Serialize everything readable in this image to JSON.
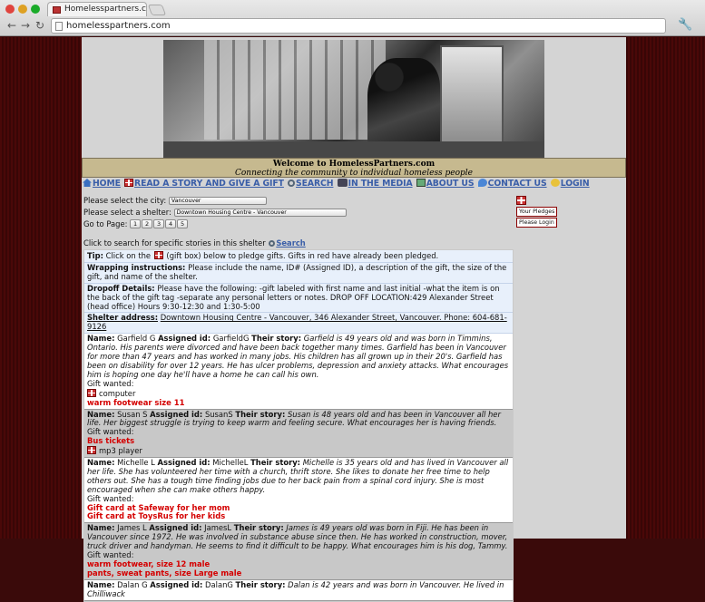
{
  "browser": {
    "tab_title": "Homelesspartners.com - W",
    "url": "homelesspartners.com"
  },
  "site": {
    "title": "Welcome to HomelessPartners.com",
    "tagline": "Connecting the community to individual homeless people"
  },
  "nav": {
    "home": "HOME",
    "story": "READ A STORY AND GIVE A GIFT",
    "search": "SEARCH",
    "media": "IN THE MEDIA",
    "about": "ABOUT US",
    "contact": "CONTACT US",
    "login": "LOGIN"
  },
  "form": {
    "city_label": "Please select the city:",
    "city_value": "Vancouver",
    "shelter_label": "Please select a shelter:",
    "shelter_value": "Downtown Housing Centre - Vancouver",
    "goto_label": "Go to Page:",
    "pages": [
      "1",
      "2",
      "3",
      "4",
      "5"
    ]
  },
  "sidebar": {
    "pledges": "Your Pledges",
    "login": "Please Login"
  },
  "search_line": {
    "text": "Click to search for specific stories in this shelter",
    "link": "Search"
  },
  "tip": {
    "label": "Tip:",
    "before": "Click on the",
    "after": "(gift box) below to pledge gifts. Gifts in red have already been pledged."
  },
  "wrapping": {
    "label": "Wrapping instructions:",
    "text": "Please include the name, ID# (Assigned ID), a description of the gift, the size of the gift, and name of the shelter."
  },
  "dropoff": {
    "label": "Dropoff Details:",
    "text": "Please have the following: -gift labeled with first name and last initial -what the item is on the back of the gift tag -separate any personal letters or notes. DROP OFF LOCATION:429 Alexander Street (head office) Hours 9:30-12:30 and 1:30-5:00"
  },
  "shelter": {
    "label": "Shelter address:",
    "text": "Downtown Housing Centre - Vancouver, 346 Alexander Street, Vancouver. Phone: 604-681-9126"
  },
  "labels": {
    "name": "Name:",
    "assigned": "Assigned id:",
    "story": "Their story:",
    "gift_wanted": "Gift wanted:"
  },
  "people": [
    {
      "name": "Garfield G",
      "id": "GarfieldG",
      "story": "Garfield is 49 years old and was born in Timmins, Ontario. His parents were divorced and have been back together many times. Garfield has been in Vancouver for more than 47 years and has worked in many jobs. His children has all grown up in their 20's. Garfield has been on disability for over 12 years. He has ulcer problems, depression and anxiety attacks. What encourages him is hoping one day he'll have a home he can call his own.",
      "gifts": [
        {
          "text": "computer",
          "pledged": false
        },
        {
          "text": "warm footwear size 11",
          "pledged": true
        }
      ]
    },
    {
      "name": "Susan S",
      "id": "SusanS",
      "story": "Susan is 48 years old and has been in Vancouver all her life. Her biggest struggle is trying to keep warm and feeling secure. What encourages her is having friends.",
      "gifts": [
        {
          "text": "Bus tickets",
          "pledged": true
        },
        {
          "text": "mp3 player",
          "pledged": false
        }
      ]
    },
    {
      "name": "Michelle L",
      "id": "MichelleL",
      "story": "Michelle is 35 years old and has lived in Vancouver all her life. She has volunteered her time with a church, thrift store. She likes to donate her free time to help others out. She has a tough time finding jobs due to her back pain from a spinal cord injury. She is most encouraged when she can make others happy.",
      "gifts": [
        {
          "text": "Gift card at Safeway for her mom",
          "pledged": true
        },
        {
          "text": "Gift card at ToysRus for her kids",
          "pledged": true
        }
      ]
    },
    {
      "name": "James L",
      "id": "JamesL",
      "story": "James is 49 years old was born in Fiji. He has been in Vancouver since 1972. He was involved in substance abuse since then. He has worked in construction, mover, truck driver and handyman. He seems to find it difficult to be happy. What encourages him is his dog, Tammy.",
      "gifts": [
        {
          "text": "warm footwear, size 12 male",
          "pledged": true
        },
        {
          "text": "pants, sweat pants, size Large male",
          "pledged": true
        }
      ]
    },
    {
      "name": "Dalan G",
      "id": "DalanG",
      "story": "Dalan is 42 years and was born in Vancouver. He lived in Chilliwack",
      "gifts": []
    }
  ]
}
